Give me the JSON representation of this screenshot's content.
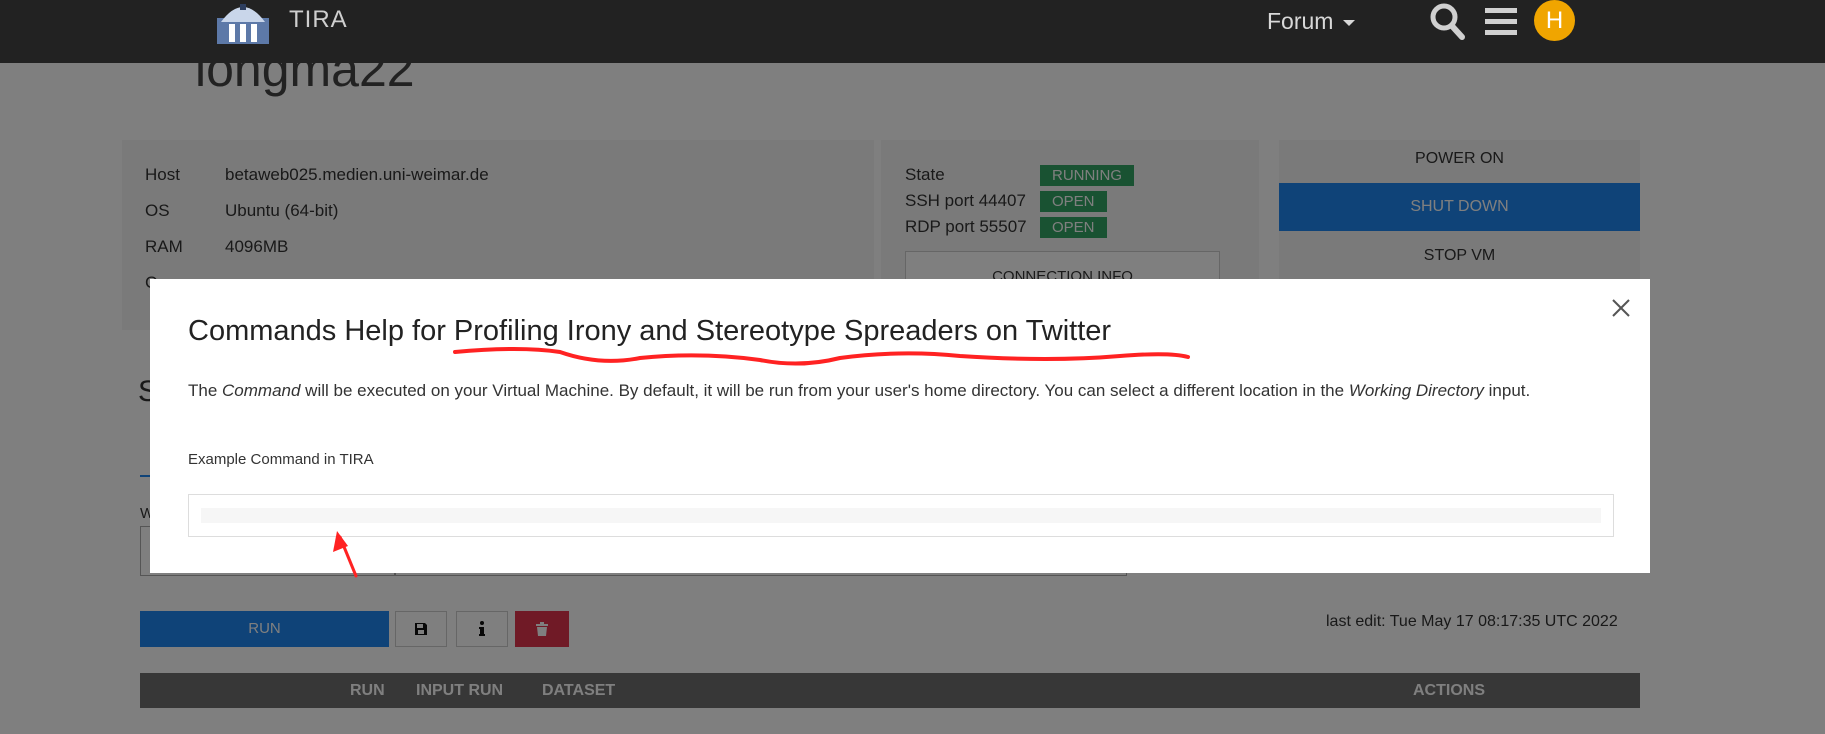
{
  "navbar": {
    "brand": "TIRA",
    "forum_label": "Forum",
    "avatar_letter": "H",
    "avatar_color": "#f0a500"
  },
  "page": {
    "title_fragment": "iongma22",
    "host_info": [
      {
        "key": "Host",
        "value": "betaweb025.medien.uni-weimar.de"
      },
      {
        "key": "OS",
        "value": "Ubuntu (64-bit)"
      },
      {
        "key": "RAM",
        "value": "4096MB"
      }
    ],
    "partial_row_letter": "C",
    "state": [
      {
        "label": "State",
        "badge": "RUNNING"
      },
      {
        "label": "SSH port 44407",
        "badge": "OPEN"
      },
      {
        "label": "RDP port 55507",
        "badge": "OPEN"
      }
    ],
    "connection_info_label": "CONNECTION INFO",
    "power_on_label": "POWER ON",
    "shut_down_label": "SHUT DOWN",
    "stop_vm_label": "STOP VM",
    "section_letter": "S",
    "working_letter": "W",
    "run_label": "RUN",
    "last_edit": "last edit: Tue May 17 08:17:35 UTC 2022",
    "table_headers": {
      "run": "RUN",
      "input_run": "INPUT RUN",
      "dataset": "DATASET",
      "actions": "ACTIONS"
    },
    "accent_color": "#1e87f0",
    "status_color": "#32a564",
    "danger_color": "#e0354c"
  },
  "modal": {
    "title": "Commands Help for Profiling Irony and Stereotype Spreaders on Twitter",
    "text_part1": "The ",
    "text_em1": "Command",
    "text_part2": " will be executed on your Virtual Machine. By default, it will be run from your user's home directory. You can select a different location in the ",
    "text_em2": "Working Directory",
    "text_part3": " input.",
    "example_label": "Example Command in TIRA",
    "example_command": ""
  },
  "annotation_color": "#ff2222"
}
